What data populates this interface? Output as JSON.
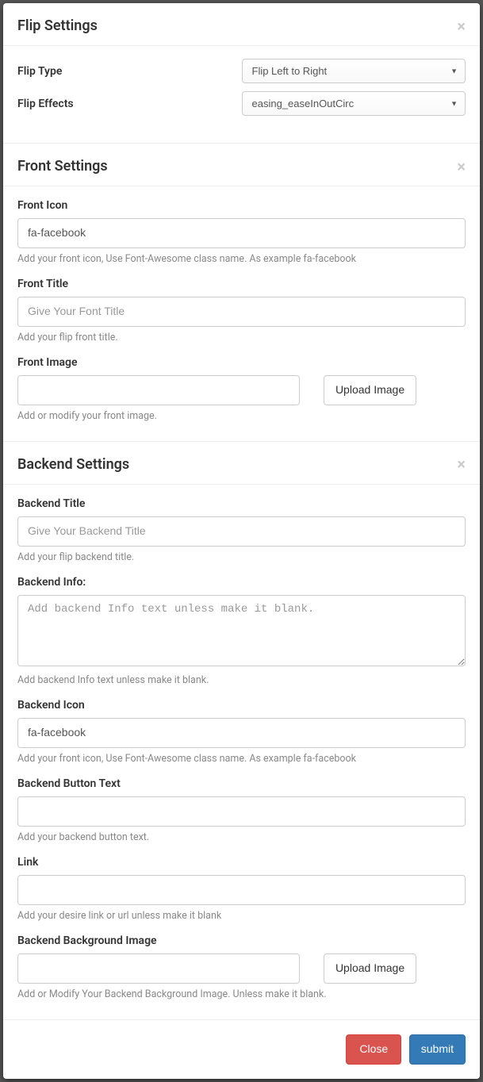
{
  "flip": {
    "title": "Flip Settings",
    "type_label": "Flip Type",
    "type_value": "Flip Left to Right",
    "effects_label": "Flip Effects",
    "effects_value": "easing_easeInOutCirc"
  },
  "front": {
    "title": "Front Settings",
    "icon_label": "Front Icon",
    "icon_value": "fa-facebook",
    "icon_help": "Add your front icon, Use Font-Awesome class name. As example fa-facebook",
    "title_label": "Front Title",
    "title_placeholder": "Give Your Font Title",
    "title_help": "Add your flip front title.",
    "image_label": "Front Image",
    "image_button": "Upload Image",
    "image_help": "Add or modify your front image."
  },
  "backend": {
    "title": "Backend Settings",
    "title_label": "Backend Title",
    "title_placeholder": "Give Your Backend Title",
    "title_help": "Add your flip backend title.",
    "info_label": "Backend Info:",
    "info_placeholder": "Add backend Info text unless make it blank.",
    "info_help": "Add backend Info text unless make it blank.",
    "icon_label": "Backend Icon",
    "icon_value": "fa-facebook",
    "icon_help": "Add your front icon, Use Font-Awesome class name. As example fa-facebook",
    "button_text_label": "Backend Button Text",
    "button_text_help": "Add your backend button text.",
    "link_label": "Link",
    "link_help": "Add your desire link or url unless make it blank",
    "bg_image_label": "Backend Background Image",
    "bg_image_button": "Upload Image",
    "bg_image_help": "Add or Modify Your Backend Background Image. Unless make it blank."
  },
  "footer": {
    "close": "Close",
    "submit": "submit"
  }
}
